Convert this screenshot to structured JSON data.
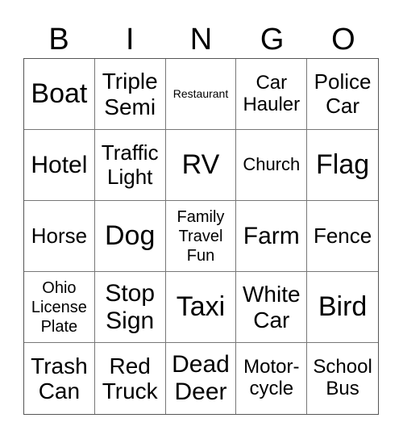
{
  "header": [
    "B",
    "I",
    "N",
    "G",
    "O"
  ],
  "cells": [
    "Boat",
    "Triple\nSemi",
    "Restaurant",
    "Car\nHauler",
    "Police\nCar",
    "Hotel",
    "Traffic\nLight",
    "RV",
    "Church",
    "Flag",
    "Horse",
    "Dog",
    "Family\nTravel\nFun",
    "Farm",
    "Fence",
    "Ohio\nLicense\nPlate",
    "Stop\nSign",
    "Taxi",
    "White\nCar",
    "Bird",
    "Trash\nCan",
    "Red\nTruck",
    "Dead\nDeer",
    "Motor-\ncycle",
    "School\nBus"
  ]
}
